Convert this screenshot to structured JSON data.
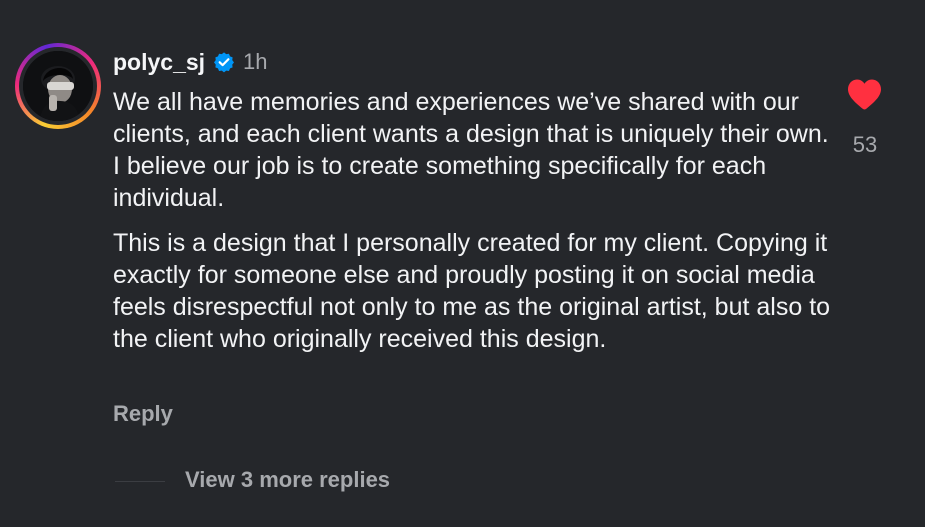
{
  "comment": {
    "username": "polyc_sj",
    "verified": true,
    "time": "1h",
    "paragraphs": [
      "We all have memories and experiences we’ve shared with our clients, and each client wants a design that is uniquely their own. I believe our job is to create something specifically for each individual.",
      "This is a design that I personally created for my client. Copying it exactly for someone else and proudly posting it on social media feels disrespectful not only to me as the original artist, but also to the client who originally received this design."
    ],
    "reply_label": "Reply",
    "likes": "53",
    "view_replies_label": "View 3 more replies"
  },
  "colors": {
    "background": "#25272b",
    "text": "#f2f3f5",
    "muted": "#a7a9ad",
    "like": "#ff3040",
    "verified": "#0095f6"
  },
  "icons": {
    "verified": "verified-badge-icon",
    "like": "heart-icon"
  }
}
